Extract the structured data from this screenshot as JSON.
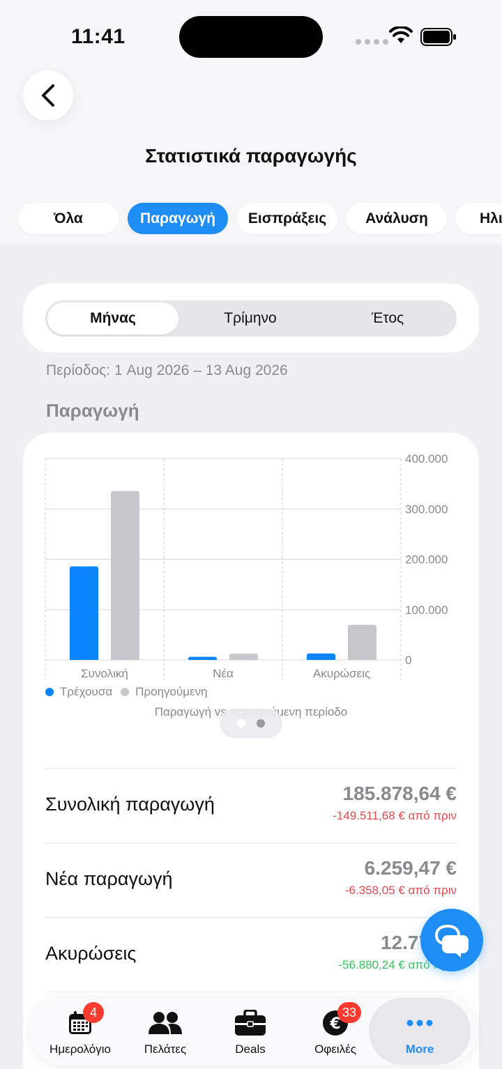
{
  "status": {
    "time": "11:41"
  },
  "header": {
    "title": "Στατιστικά παραγωγής"
  },
  "filter_tabs": [
    {
      "label": "Όλα"
    },
    {
      "label": "Παραγωγή",
      "active": true
    },
    {
      "label": "Εισπράξεις"
    },
    {
      "label": "Ανάλυση"
    },
    {
      "label": "Ηλι"
    }
  ],
  "period_selector": {
    "options": [
      "Μήνας",
      "Τρίμηνο",
      "Έτος"
    ],
    "selected": "Μήνας"
  },
  "period_text": "Περίοδος: 1 Aug 2026 – 13 Aug 2026",
  "section_title": "Παραγωγή",
  "chart_data": {
    "type": "bar",
    "categories": [
      "Συνολική",
      "Νέα",
      "Ακυρώσεις"
    ],
    "series": [
      {
        "name": "Τρέχουσα",
        "color": "#0a84ff",
        "values": [
          185878.64,
          6259.47,
          12778
        ]
      },
      {
        "name": "Προηγούμενη",
        "color": "#c8c8cc",
        "values": [
          335390.32,
          12617.52,
          69658
        ]
      }
    ],
    "y_ticks": [
      "400.000",
      "300.000",
      "200.000",
      "100.000",
      "0"
    ],
    "ylim": [
      0,
      400000
    ],
    "caption": "Παραγωγή vs προηγούμενη περίοδο",
    "grid": true,
    "legend_position": "bottom-left"
  },
  "stats": [
    {
      "label": "Συνολική παραγωγή",
      "value": "185.878,64 €",
      "delta": "-149.511,68 € από πριν",
      "trend": "neg"
    },
    {
      "label": "Νέα παραγωγή",
      "value": "6.259,47 €",
      "delta": "-6.358,05 € από πριν",
      "trend": "neg"
    },
    {
      "label": "Ακυρώσεις",
      "value": "12.778,8",
      "delta": "-56.880,24 € από πριν",
      "trend": "pos"
    }
  ],
  "bottom_nav": [
    {
      "label": "Ημερολόγιο",
      "icon": "calendar-icon",
      "badge": "4"
    },
    {
      "label": "Πελάτες",
      "icon": "people-icon"
    },
    {
      "label": "Deals",
      "icon": "briefcase-icon"
    },
    {
      "label": "Οφειλές",
      "icon": "euro-icon",
      "badge": "33"
    },
    {
      "label": "More",
      "icon": "more-icon",
      "active": true
    }
  ],
  "colors": {
    "accent": "#1e8ef5",
    "negative": "#e5484d",
    "positive": "#34c759",
    "badge": "#ff3b30"
  }
}
